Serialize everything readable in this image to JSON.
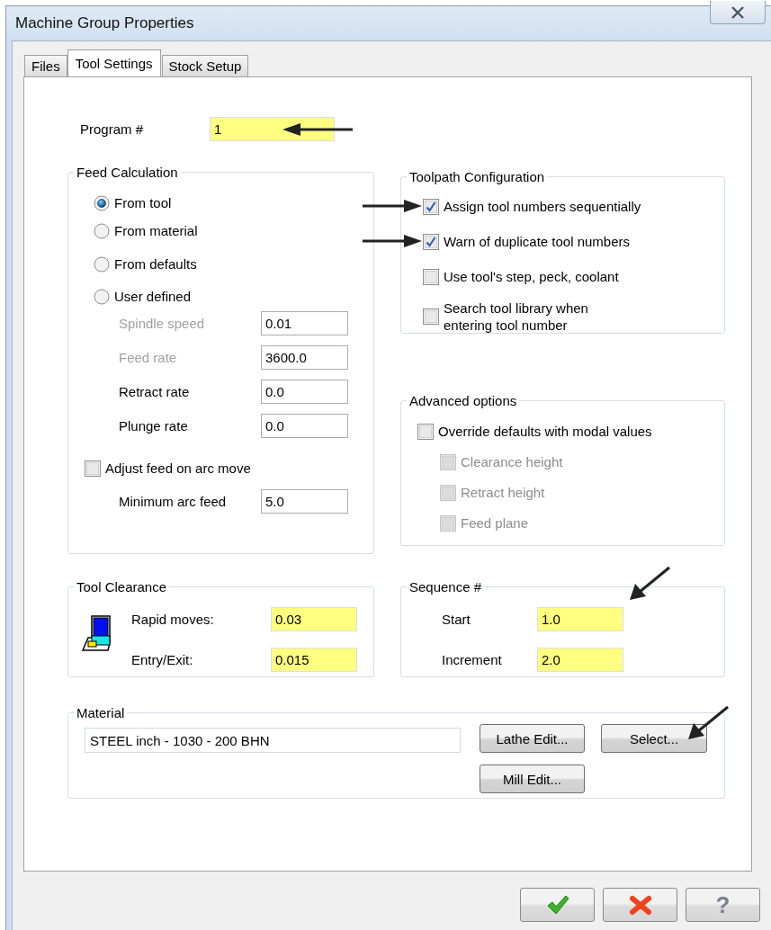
{
  "window": {
    "title": "Machine Group Properties"
  },
  "tabs": [
    {
      "label": "Files",
      "selected": false
    },
    {
      "label": "Tool Settings",
      "selected": true
    },
    {
      "label": "Stock Setup",
      "selected": false
    }
  ],
  "program": {
    "label": "Program #",
    "value": "1",
    "highlighted": true,
    "arrow": {
      "kind": "left"
    }
  },
  "feed_calculation": {
    "title": "Feed Calculation",
    "options": [
      {
        "label": "From tool",
        "selected": true
      },
      {
        "label": "From material",
        "selected": false
      },
      {
        "label": "From defaults",
        "selected": false
      },
      {
        "label": "User defined",
        "selected": false
      }
    ],
    "fields": [
      {
        "label": "Spindle speed",
        "value": "0.01",
        "disabled": true
      },
      {
        "label": "Feed rate",
        "value": "3600.0",
        "disabled": true
      },
      {
        "label": "Retract rate",
        "value": "0.0",
        "disabled": false
      },
      {
        "label": "Plunge rate",
        "value": "0.0",
        "disabled": false
      }
    ],
    "adjust_feed": {
      "label": "Adjust feed on arc move",
      "checked": false
    },
    "minimum_arc_feed": {
      "label": "Minimum arc feed",
      "value": "5.0"
    }
  },
  "toolpath_configuration": {
    "title": "Toolpath Configuration",
    "options": [
      {
        "label": "Assign tool numbers sequentially",
        "checked": true,
        "arrow": {
          "kind": "right"
        }
      },
      {
        "label": "Warn of duplicate tool numbers",
        "checked": true,
        "arrow": {
          "kind": "right"
        }
      },
      {
        "label": "Use tool's step, peck, coolant",
        "checked": false
      },
      {
        "label": "Search tool library when\nentering tool number",
        "checked": false
      }
    ]
  },
  "advanced_options": {
    "title": "Advanced options",
    "override": {
      "label": "Override defaults with modal values",
      "checked": false
    },
    "options": [
      {
        "label": "Clearance height",
        "checked": false,
        "disabled": true
      },
      {
        "label": "Retract height",
        "checked": false,
        "disabled": true
      },
      {
        "label": "Feed plane",
        "checked": false,
        "disabled": true
      }
    ]
  },
  "tool_clearance": {
    "title": "Tool Clearance",
    "fields": [
      {
        "label": "Rapid moves:",
        "value": "0.03",
        "highlighted": true
      },
      {
        "label": "Entry/Exit:",
        "value": "0.015",
        "highlighted": true
      }
    ]
  },
  "sequence": {
    "title": "Sequence #",
    "arrow": {
      "kind": "down-left"
    },
    "fields": [
      {
        "label": "Start",
        "value": "1.0",
        "highlighted": true
      },
      {
        "label": "Increment",
        "value": "2.0",
        "highlighted": true
      }
    ]
  },
  "material": {
    "title": "Material",
    "value": "STEEL inch - 1030 - 200 BHN",
    "buttons": [
      {
        "label": "Lathe Edit..."
      },
      {
        "label": "Select...",
        "arrow": {
          "kind": "down-left"
        }
      },
      {
        "label": "Mill Edit..."
      }
    ]
  },
  "footer_buttons": [
    {
      "kind": "ok"
    },
    {
      "kind": "cancel"
    },
    {
      "kind": "help",
      "glyph": "?"
    }
  ]
}
